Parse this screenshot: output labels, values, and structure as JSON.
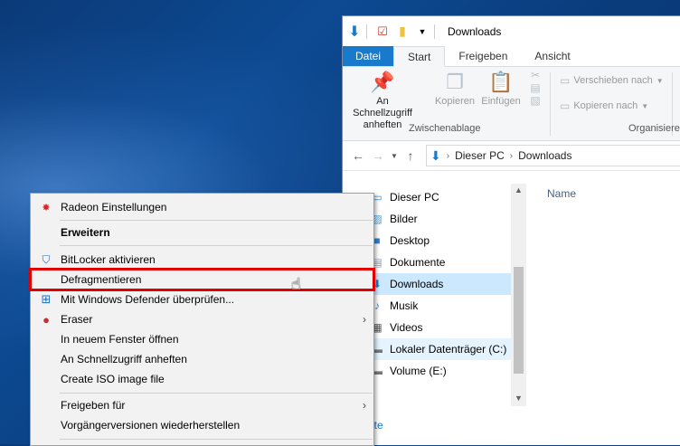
{
  "explorer": {
    "title": "Downloads",
    "tabs": [
      "Datei",
      "Start",
      "Freigeben",
      "Ansicht"
    ],
    "ribbon": {
      "pin_label": "An Schnellzugriff anheften",
      "copy_label": "Kopieren",
      "paste_label": "Einfügen",
      "clipboard_group": "Zwischenablage",
      "move_to": "Verschieben nach",
      "copy_to": "Kopieren nach",
      "organize_group": "Organisiere"
    },
    "address": {
      "crumbs": [
        "Dieser PC",
        "Downloads"
      ]
    },
    "nav": [
      {
        "label": "Dieser PC",
        "icon": "pc-icon"
      },
      {
        "label": "Bilder",
        "icon": "pictures-icon"
      },
      {
        "label": "Desktop",
        "icon": "desktop-icon"
      },
      {
        "label": "Dokumente",
        "icon": "documents-icon"
      },
      {
        "label": "Downloads",
        "icon": "downloads-icon"
      },
      {
        "label": "Musik",
        "icon": "music-icon"
      },
      {
        "label": "Videos",
        "icon": "videos-icon"
      },
      {
        "label": "Lokaler Datenträger (C:)",
        "icon": "drive-icon"
      },
      {
        "label": "Volume (E:)",
        "icon": "drive-icon"
      }
    ],
    "column_header": "Name",
    "status_partial": "lemente"
  },
  "context_menu": {
    "items": [
      {
        "label": "Radeon Einstellungen",
        "icon": "radeon-icon"
      },
      {
        "label": "Erweitern",
        "bold": true
      },
      {
        "label": "BitLocker aktivieren",
        "icon": "shield-icon"
      },
      {
        "label": "Defragmentieren",
        "highlighted": true
      },
      {
        "label": "Mit Windows Defender überprüfen...",
        "icon": "defender-icon"
      },
      {
        "label": "Eraser",
        "icon": "eraser-icon",
        "submenu": true
      },
      {
        "label": "In neuem Fenster öffnen"
      },
      {
        "label": "An Schnellzugriff anheften"
      },
      {
        "label": "Create ISO image file"
      },
      {
        "label": "Freigeben für",
        "submenu": true
      },
      {
        "label": "Vorgängerversionen wiederherstellen"
      }
    ]
  },
  "colors": {
    "accent": "#1979ca",
    "highlight_outline": "#e00000",
    "selection": "#cce8ff"
  }
}
